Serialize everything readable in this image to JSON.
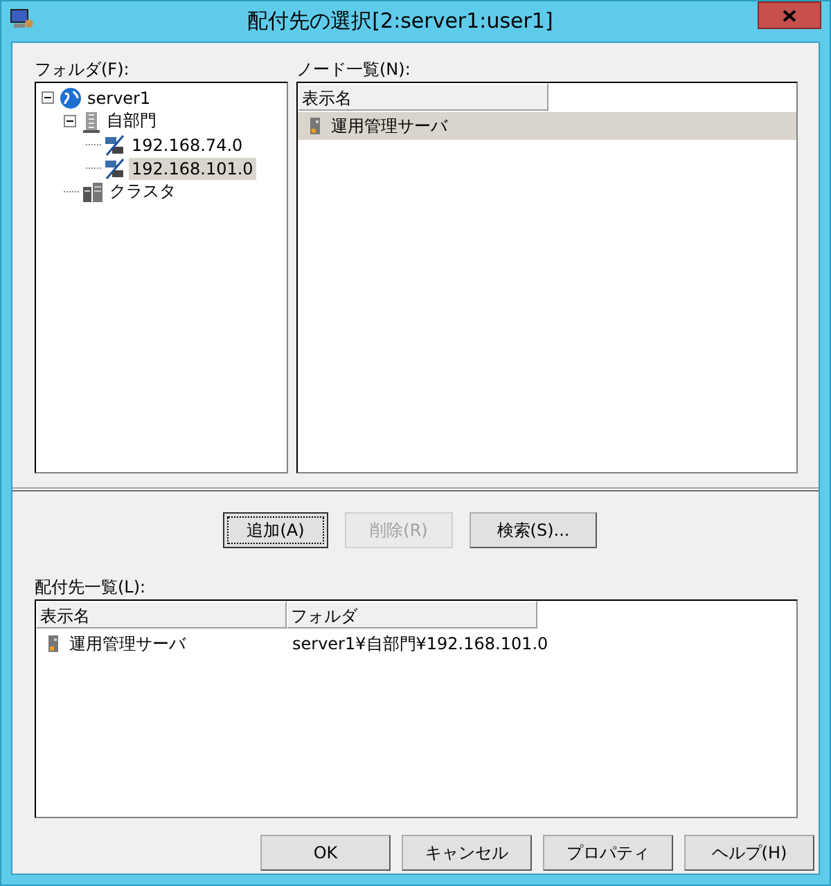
{
  "window": {
    "title": "配付先の選択[2:server1:user1]"
  },
  "folder_tree": {
    "label": "フォルダ(F):",
    "items": [
      {
        "label": "server1",
        "kind": "globe",
        "expanded": true,
        "selected": false,
        "children": [
          {
            "label": "自部門",
            "kind": "building",
            "expanded": true,
            "selected": false,
            "children": [
              {
                "label": "192.168.74.0",
                "kind": "network",
                "selected": false
              },
              {
                "label": "192.168.101.0",
                "kind": "network",
                "selected": true
              }
            ]
          },
          {
            "label": "クラスタ",
            "kind": "cluster",
            "selected": false
          }
        ]
      }
    ]
  },
  "node_list": {
    "label": "ノード一覧(N):",
    "columns": [
      "表示名"
    ],
    "rows": [
      {
        "cells": [
          "運用管理サーバ"
        ],
        "selected": true
      }
    ]
  },
  "actions": [
    {
      "label": "追加(A)",
      "disabled": false,
      "focused": true
    },
    {
      "label": "削除(R)",
      "disabled": true,
      "focused": false
    },
    {
      "label": "検索(S)...",
      "disabled": false,
      "focused": false
    }
  ],
  "target_list": {
    "label": "配付先一覧(L):",
    "columns": [
      "表示名",
      "フォルダ"
    ],
    "rows": [
      {
        "cells": [
          "運用管理サーバ",
          "server1¥自部門¥192.168.101.0"
        ],
        "selected": false
      }
    ]
  },
  "buttons": [
    {
      "label": "OK"
    },
    {
      "label": "キャンセル"
    },
    {
      "label": "プロパティ"
    },
    {
      "label": "ヘルプ(H)"
    }
  ]
}
